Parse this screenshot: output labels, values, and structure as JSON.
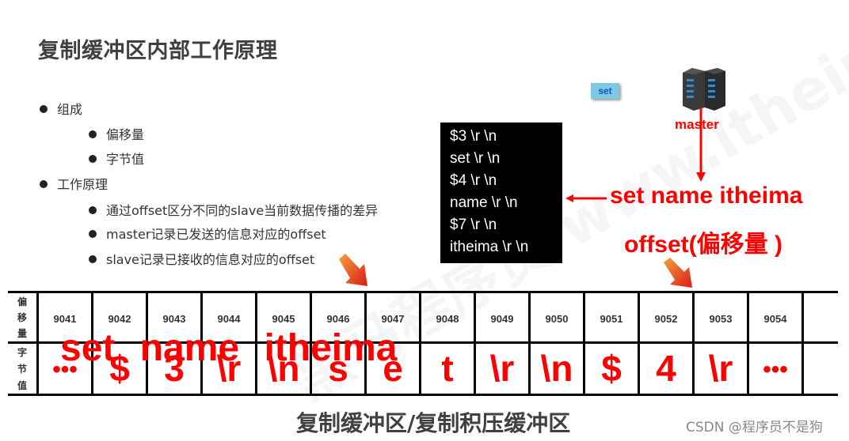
{
  "title": "复制缓冲区内部工作原理",
  "bullets": [
    {
      "label": "组成",
      "level": 1
    },
    {
      "label": "偏移量",
      "level": 2
    },
    {
      "label": "字节值",
      "level": 2
    },
    {
      "label": "工作原理",
      "level": 1
    },
    {
      "label": "通过offset区分不同的slave当前数据传播的差异",
      "level": 2
    },
    {
      "label": "master记录已发送的信息对应的offset",
      "level": 2
    },
    {
      "label": "slave记录已接收的信息对应的offset",
      "level": 2
    }
  ],
  "command_box": {
    "lines": [
      "$3 \\r \\n",
      "set \\r \\n",
      "$4 \\r \\n",
      "name \\r \\n",
      "$7 \\r \\n",
      "itheima \\r \\n"
    ]
  },
  "set_badge": "set",
  "master_label": "master",
  "command_text": "set name itheima",
  "offset_text": "offset(偏移量 )",
  "buffer": {
    "row_labels": {
      "offset": [
        "偏",
        "移",
        "量"
      ],
      "bytes": [
        "字",
        "节",
        "值"
      ]
    },
    "offsets": [
      "9041",
      "9042",
      "9043",
      "9044",
      "9045",
      "9046",
      "9047",
      "9048",
      "9049",
      "9050",
      "9051",
      "9052",
      "9053",
      "9054",
      ""
    ],
    "bytes": [
      "•••",
      "$",
      "3",
      "\\r",
      "\\n",
      "s",
      "e",
      "t",
      "\\r",
      "\\n",
      "$",
      "4",
      "\\r",
      "•••",
      ""
    ],
    "overlay_text": "set name itheima"
  },
  "caption": "复制缓冲区/复制积压缓冲区",
  "watermark": "CSDN @程序员不是狗",
  "background_watermark": "黑马程序员 www.itheima.com",
  "colors": {
    "accent": "#ff0000",
    "title": "#404040",
    "badge_bg": "#7ec8e3",
    "badge_text": "#0b5ea8"
  }
}
